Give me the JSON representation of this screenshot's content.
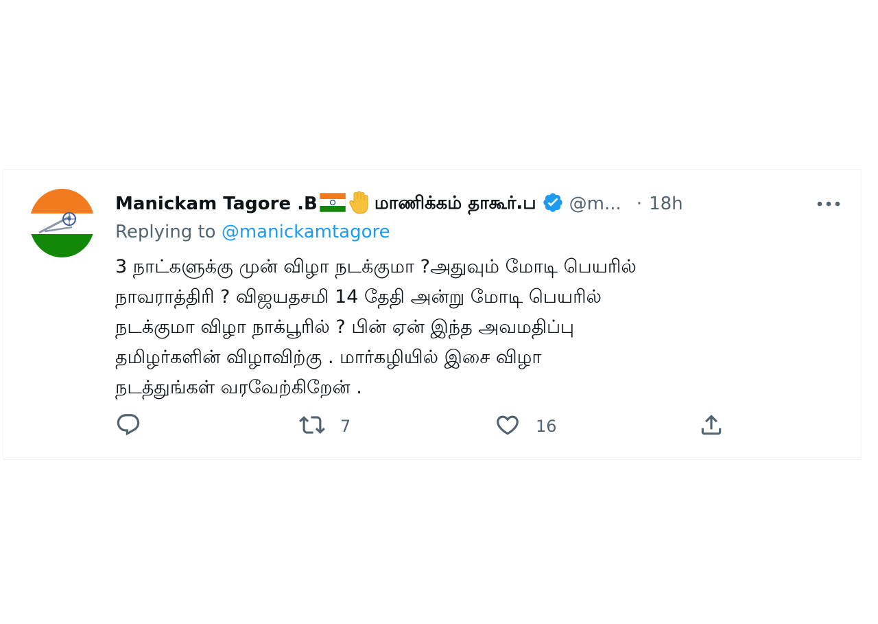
{
  "tweet": {
    "author_name": "Manickam Tagore .B",
    "author_name_tamil": "மாணிக்கம் தாகூர்.ப",
    "handle": "@m...",
    "separator": "·",
    "timestamp": "18h",
    "replying_prefix": "Replying to ",
    "replying_handle": "@manickamtagore",
    "text_lines": [
      "3 நாட்களுக்கு முன் விழா நடக்குமா ?அதுவும் மோடி பெயரில்",
      "நாவராத்திரி ? விஜயதசமி 14 தேதி அன்று மோடி பெயரில்",
      "நடக்குமா விழா நாக்பூரில் ? பின் ஏன் இந்த அவமதிப்பு",
      "தமிழர்களின் விழாவிற்கு . மார்கழியில் இசை விழா",
      "நடத்துங்கள் வரவேற்கிறேன் ."
    ],
    "reply_count": "",
    "retweet_count": "7",
    "like_count": "16"
  },
  "icons": {
    "avatar": "indian-flag-avatar-icon",
    "flag": "india-flag-emoji-icon",
    "hand": "raised-hand-emoji-icon",
    "verified": "verified-badge-icon",
    "more": "more-options-icon",
    "reply": "reply-icon",
    "retweet": "retweet-icon",
    "like": "heart-icon",
    "share": "share-icon"
  },
  "colors": {
    "text_primary": "#0f1419",
    "text_secondary": "#536471",
    "link": "#1d9bf0",
    "verified": "#1d9bf0",
    "saffron": "#f47a1f",
    "green": "#138808"
  }
}
